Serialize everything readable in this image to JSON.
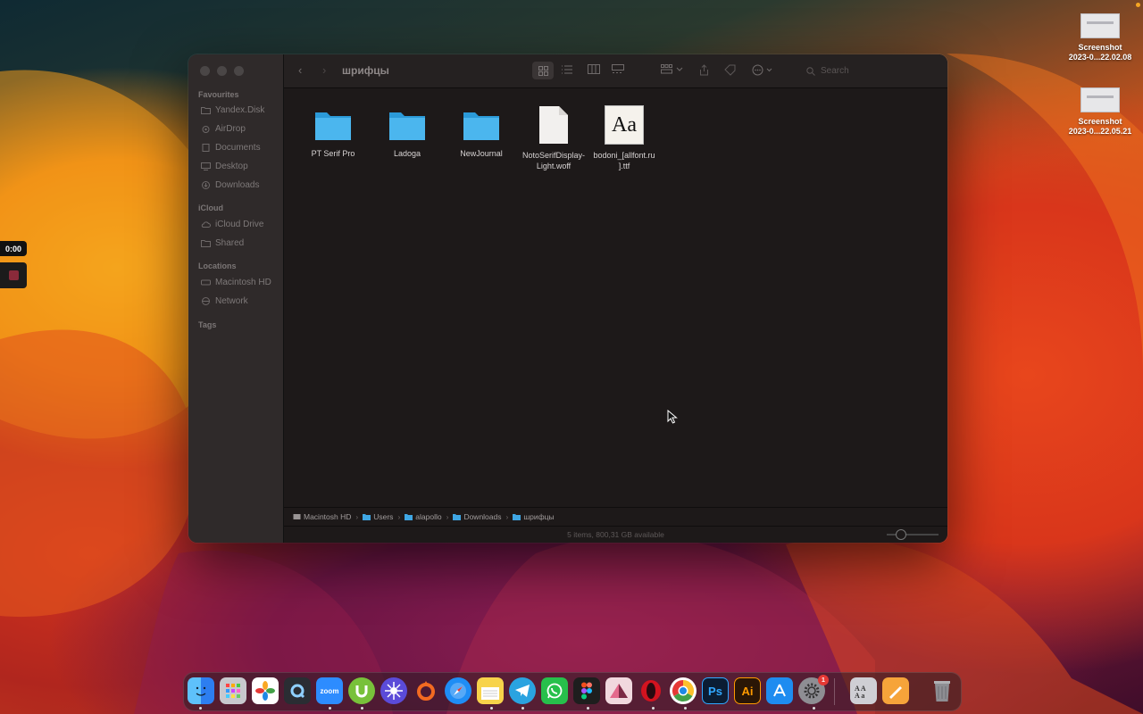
{
  "window": {
    "title": "шрифцы",
    "search_placeholder": "Search"
  },
  "sidebar": {
    "favourites_header": "Favourites",
    "favourites": [
      "Yandex.Disk",
      "AirDrop",
      "Documents",
      "Desktop",
      "Downloads"
    ],
    "icloud_header": "iCloud",
    "icloud": [
      "iCloud Drive",
      "Shared"
    ],
    "locations_header": "Locations",
    "locations": [
      "Macintosh HD",
      "Network"
    ],
    "tags_header": "Tags"
  },
  "files": [
    {
      "name": "PT Serif Pro",
      "type": "folder-icon"
    },
    {
      "name": "Ladoga",
      "type": "folder-icon"
    },
    {
      "name": "NewJournal",
      "type": "folder-icon"
    },
    {
      "name_line1": "NotoSerifDisplay-",
      "name_line2": "Light.woff",
      "type": "document-icon"
    },
    {
      "name_line1": "bodoni_[allfont.ru",
      "name_line2": "].ttf",
      "type": "font-file-icon",
      "preview": "Aa"
    }
  ],
  "pathbar": [
    "Macintosh HD",
    "Users",
    "alapollo",
    "Downloads",
    "шрифцы"
  ],
  "status": "5 items, 800,31 GB available",
  "desktop": {
    "icons": [
      {
        "line1": "Screenshot",
        "line2": "2023-0...22.02.08"
      },
      {
        "line1": "Screenshot",
        "line2": "2023-0...22.05.21"
      }
    ]
  },
  "recording": {
    "time": "0:00"
  },
  "dock": {
    "apps": [
      {
        "name": "finder-icon",
        "text": "",
        "color": "#3aa0f5"
      },
      {
        "name": "launchpad-icon",
        "text": "",
        "color": "#c9c9cf"
      },
      {
        "name": "photos-icon",
        "text": "",
        "color": "#ffffff"
      },
      {
        "name": "quicktime-icon",
        "text": "",
        "color": "#2a2d33"
      },
      {
        "name": "zoom-icon",
        "text": "zoom",
        "color": "#2d8cff"
      },
      {
        "name": "utorrent-icon",
        "text": "",
        "color": "#78c13a"
      },
      {
        "name": "spark-icon",
        "text": "",
        "color": "#5b4bd8"
      },
      {
        "name": "origin-icon",
        "text": "",
        "color": "#f26a21"
      },
      {
        "name": "safari-icon",
        "text": "",
        "color": "#1f8df5"
      },
      {
        "name": "notes-icon",
        "text": "",
        "color": "#f7d34a"
      },
      {
        "name": "telegram-icon",
        "text": "",
        "color": "#2aa3e0"
      },
      {
        "name": "whatsapp-icon",
        "text": "",
        "color": "#27c04b"
      },
      {
        "name": "figma-icon",
        "text": "",
        "color": "#1e1e1e"
      },
      {
        "name": "affinity-icon",
        "text": "",
        "color": "#e46a8c"
      },
      {
        "name": "opera-icon",
        "text": "",
        "color": "#d3131f"
      },
      {
        "name": "chrome-icon",
        "text": "",
        "color": "#ffffff"
      },
      {
        "name": "photoshop-icon",
        "text": "Ps",
        "color": "#0b1d33"
      },
      {
        "name": "illustrator-icon",
        "text": "Ai",
        "color": "#2a1606"
      },
      {
        "name": "appstore-icon",
        "text": "",
        "color": "#1e8cf0"
      },
      {
        "name": "system-settings-icon",
        "text": "",
        "color": "#8e8e93"
      },
      {
        "name": "font-book-icon",
        "text": "",
        "color": "#cfcfd4"
      },
      {
        "name": "pages-icon",
        "text": "",
        "color": "#f6a43a"
      },
      {
        "name": "trash-icon",
        "text": "",
        "color": "#9a9a9e"
      }
    ],
    "settings_badge": "1"
  }
}
